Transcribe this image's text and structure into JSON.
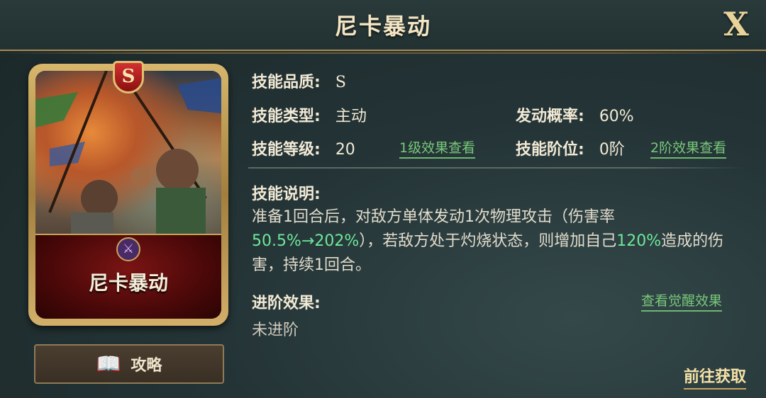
{
  "header": {
    "title": "尼卡暴动",
    "close_label": "X"
  },
  "card": {
    "grade_badge": "S",
    "name": "尼卡暴动",
    "emblem_icon": "crossed-weapons-icon"
  },
  "guide_button": {
    "label": "攻略",
    "icon": "book-icon"
  },
  "skill": {
    "quality_label": "技能品质:",
    "quality_value": "S",
    "type_label": "技能类型:",
    "type_value": "主动",
    "trigger_label": "发动概率:",
    "trigger_value": "60%",
    "level_label": "技能等级:",
    "level_value": "20",
    "level1_link": "1级效果查看",
    "rank_label": "技能阶位:",
    "rank_value": "0阶",
    "rank2_link": "2阶效果查看"
  },
  "description": {
    "label": "技能说明:",
    "part1": "准备1回合后，对敌方单体发动1次物理攻击（伤害率",
    "hl1": "50.5%→202%",
    "part2": "），若敌方处于灼烧状态，则增加自己",
    "hl2": "120%",
    "part3": "造成的伤害，持续1回合。"
  },
  "advance": {
    "label": "进阶效果:",
    "awaken_link": "查看觉醒效果",
    "value": "未进阶"
  },
  "goto_link": "前往获取",
  "colors": {
    "highlight": "#6ee89a",
    "link": "#78c87a",
    "gold": "#c9a45a"
  }
}
